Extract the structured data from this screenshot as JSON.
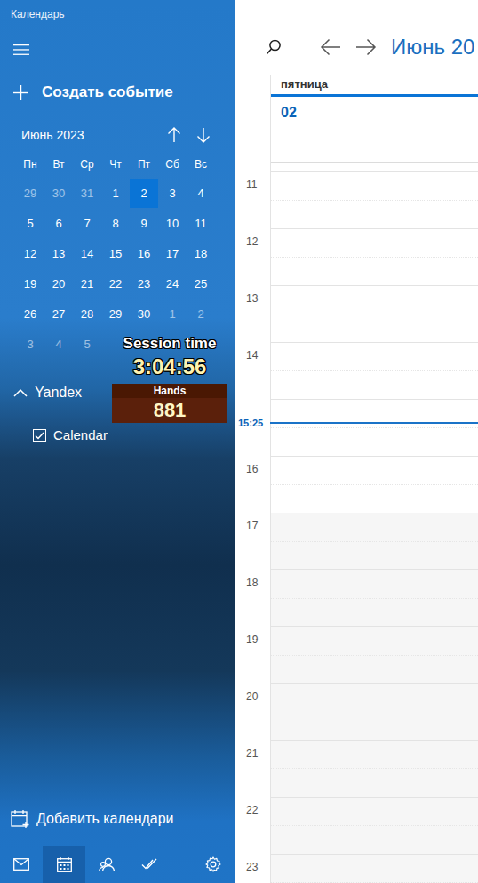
{
  "window": {
    "title": "Календарь"
  },
  "sidebar": {
    "new_event": "Создать событие",
    "mini_calendar": {
      "month": "Июнь 2023",
      "weekdays": [
        "Пн",
        "Вт",
        "Ср",
        "Чт",
        "Пт",
        "Сб",
        "Вс"
      ],
      "weeks": [
        [
          {
            "day": "29",
            "in_month": false,
            "selected": false
          },
          {
            "day": "30",
            "in_month": false,
            "selected": false
          },
          {
            "day": "31",
            "in_month": false,
            "selected": false
          },
          {
            "day": "1",
            "in_month": true,
            "selected": false
          },
          {
            "day": "2",
            "in_month": true,
            "selected": true
          },
          {
            "day": "3",
            "in_month": true,
            "selected": false
          },
          {
            "day": "4",
            "in_month": true,
            "selected": false
          }
        ],
        [
          {
            "day": "5",
            "in_month": true,
            "selected": false
          },
          {
            "day": "6",
            "in_month": true,
            "selected": false
          },
          {
            "day": "7",
            "in_month": true,
            "selected": false
          },
          {
            "day": "8",
            "in_month": true,
            "selected": false
          },
          {
            "day": "9",
            "in_month": true,
            "selected": false
          },
          {
            "day": "10",
            "in_month": true,
            "selected": false
          },
          {
            "day": "11",
            "in_month": true,
            "selected": false
          }
        ],
        [
          {
            "day": "12",
            "in_month": true,
            "selected": false
          },
          {
            "day": "13",
            "in_month": true,
            "selected": false
          },
          {
            "day": "14",
            "in_month": true,
            "selected": false
          },
          {
            "day": "15",
            "in_month": true,
            "selected": false
          },
          {
            "day": "16",
            "in_month": true,
            "selected": false
          },
          {
            "day": "17",
            "in_month": true,
            "selected": false
          },
          {
            "day": "18",
            "in_month": true,
            "selected": false
          }
        ],
        [
          {
            "day": "19",
            "in_month": true,
            "selected": false
          },
          {
            "day": "20",
            "in_month": true,
            "selected": false
          },
          {
            "day": "21",
            "in_month": true,
            "selected": false
          },
          {
            "day": "22",
            "in_month": true,
            "selected": false
          },
          {
            "day": "23",
            "in_month": true,
            "selected": false
          },
          {
            "day": "24",
            "in_month": true,
            "selected": false
          },
          {
            "day": "25",
            "in_month": true,
            "selected": false
          }
        ],
        [
          {
            "day": "26",
            "in_month": true,
            "selected": false
          },
          {
            "day": "27",
            "in_month": true,
            "selected": false
          },
          {
            "day": "28",
            "in_month": true,
            "selected": false
          },
          {
            "day": "29",
            "in_month": true,
            "selected": false
          },
          {
            "day": "30",
            "in_month": true,
            "selected": false
          },
          {
            "day": "1",
            "in_month": false,
            "selected": false
          },
          {
            "day": "2",
            "in_month": false,
            "selected": false
          }
        ],
        [
          {
            "day": "3",
            "in_month": false,
            "selected": false
          },
          {
            "day": "4",
            "in_month": false,
            "selected": false
          },
          {
            "day": "5",
            "in_month": false,
            "selected": false
          }
        ]
      ]
    },
    "accounts": [
      {
        "name": "Yandex",
        "expanded": true,
        "calendars": [
          {
            "name": "Calendar",
            "checked": true
          }
        ]
      }
    ],
    "add_calendars": "Добавить календари",
    "nav": [
      {
        "kind": "mail",
        "selected": false
      },
      {
        "kind": "calendar",
        "selected": true
      },
      {
        "kind": "people",
        "selected": false
      },
      {
        "kind": "todo",
        "selected": false
      },
      {
        "kind": "settings",
        "selected": false
      }
    ]
  },
  "overlay": {
    "session_label": "Session time",
    "session_time": "3:04:56",
    "hands_label": "Hands",
    "hands": "881"
  },
  "day_view": {
    "title": "Июнь 20",
    "weekday": "пятница",
    "date": "02",
    "hours": [
      {
        "label": "11",
        "kind": "hour",
        "off_hours": false
      },
      {
        "label": "12",
        "kind": "hour",
        "off_hours": false
      },
      {
        "label": "13",
        "kind": "hour",
        "off_hours": false
      },
      {
        "label": "14",
        "kind": "hour",
        "off_hours": false
      },
      {
        "label": "15:25",
        "kind": "now",
        "off_hours": false
      },
      {
        "label": "16",
        "kind": "hour",
        "off_hours": false
      },
      {
        "label": "17",
        "kind": "hour",
        "off_hours": true
      },
      {
        "label": "18",
        "kind": "hour",
        "off_hours": true
      },
      {
        "label": "19",
        "kind": "hour",
        "off_hours": true
      },
      {
        "label": "20",
        "kind": "hour",
        "off_hours": true
      },
      {
        "label": "21",
        "kind": "hour",
        "off_hours": true
      },
      {
        "label": "22",
        "kind": "hour",
        "off_hours": true
      },
      {
        "label": "23",
        "kind": "hour",
        "off_hours": true
      }
    ]
  }
}
